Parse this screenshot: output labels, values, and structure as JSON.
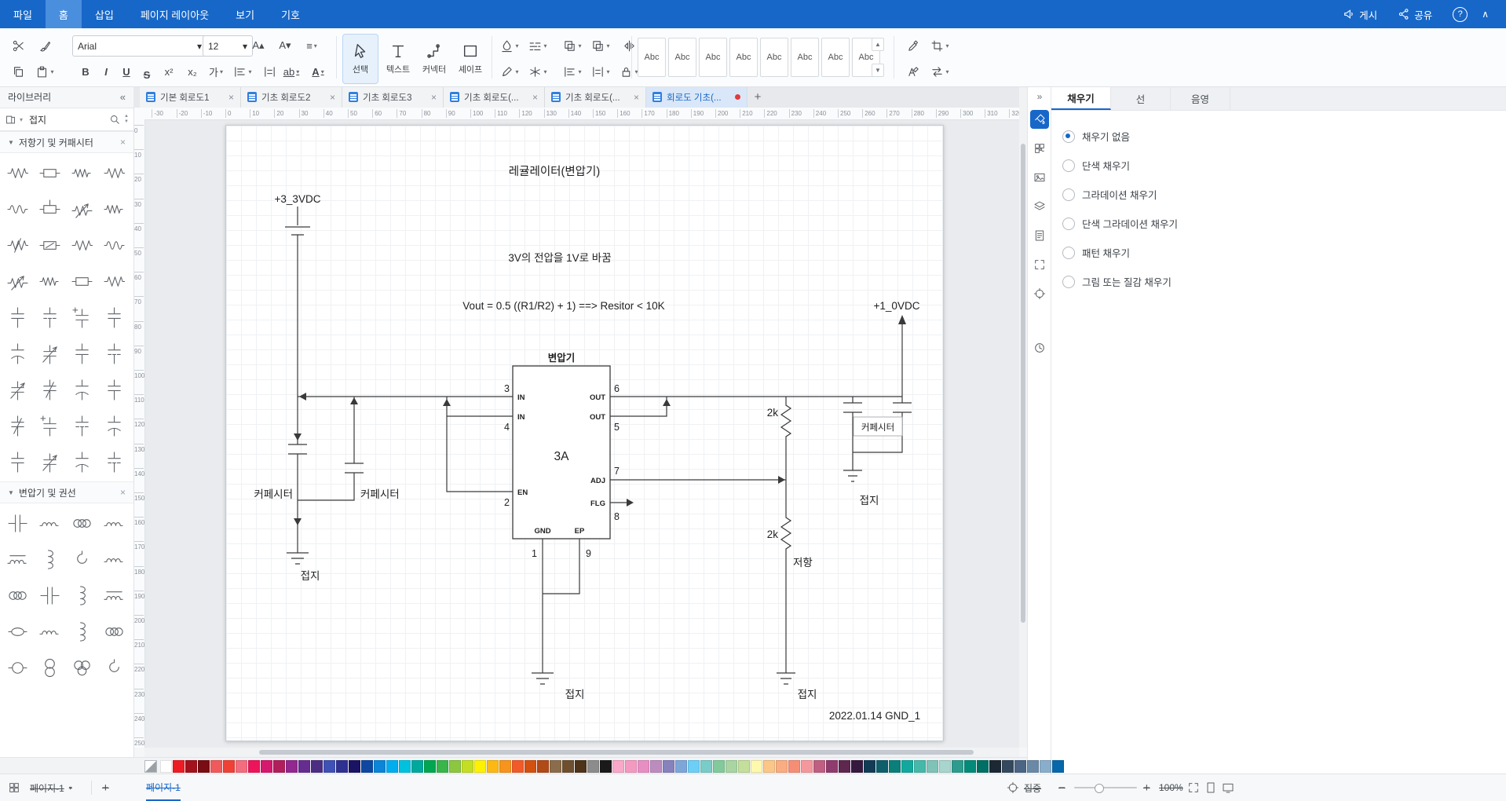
{
  "menubar": {
    "items": [
      {
        "id": "file",
        "label": "파일"
      },
      {
        "id": "home",
        "label": "홈",
        "active": true
      },
      {
        "id": "insert",
        "label": "삽입"
      },
      {
        "id": "page-layout",
        "label": "페이지 레이아웃"
      },
      {
        "id": "view",
        "label": "보기"
      },
      {
        "id": "symbols",
        "label": "기호"
      }
    ],
    "publish": "게시",
    "share": "공유"
  },
  "icons": {
    "dropdown": "▾",
    "spin_up": "▲",
    "spin_down": "▼",
    "tri_down": "▼",
    "collapse_left": "«",
    "expand_right": "»",
    "close": "×",
    "plus": "+",
    "minus": "−",
    "help": "?",
    "chevron_up": "∧",
    "bold": "B",
    "italic": "I",
    "underline": "U",
    "strike": "S",
    "superscript": "x²",
    "subscript": "x₂",
    "font_kr": "가",
    "highlight": "ab",
    "font_color": "A",
    "font_up": "A▴",
    "font_down": "A▾",
    "align": "≡"
  },
  "toolbar": {
    "font": "Arial",
    "font_size": "12",
    "select_label": "선택",
    "text_label": "텍스트",
    "connector_label": "커넥터",
    "shape_label": "셰이프",
    "style_sample": "Abc",
    "style_count": 8
  },
  "library": {
    "title": "라이브러리",
    "search_value": "접지",
    "sections": [
      {
        "title": "저항기 및 커패시터",
        "items": [
          "res-zz",
          "res-box",
          "res-zz-d",
          "res-zz",
          "res-wave",
          "res-tap",
          "res-arr",
          "res-zz-d",
          "res-slash",
          "res-box-s",
          "res-zz",
          "res-wave",
          "res-arr",
          "res-zz-d",
          "res-box",
          "res-zz",
          "cap-v",
          "cap-dash",
          "cap-plus",
          "cap-v",
          "cap-pol",
          "cap-arr",
          "cap-v",
          "cap-dash",
          "cap-arr",
          "cap-slash",
          "cap-pol",
          "cap-v",
          "cap-slash",
          "cap-plus",
          "cap-dash",
          "cap-pol",
          "cap-v",
          "cap-arr",
          "cap-pol",
          "cap-dash"
        ]
      },
      {
        "title": "변압기 및 권선",
        "items": [
          "pair-bars",
          "coil",
          "coil-loop",
          "coil",
          "coil-bar",
          "coil-v",
          "hook",
          "coil",
          "coil-loop",
          "pair-bars",
          "coil-v",
          "coil-bar",
          "bead",
          "coil",
          "coil-v",
          "coil-loop",
          "ring",
          "circ-v",
          "trans3",
          "hook"
        ]
      }
    ]
  },
  "tabs": {
    "items": [
      {
        "label": "기본 회로도1"
      },
      {
        "label": "기초 회로도2"
      },
      {
        "label": "기초 회로도3"
      },
      {
        "label": "기초 회로도(..."
      },
      {
        "label": "기초 회로도(..."
      },
      {
        "label": "회로도 기초(...",
        "active": true,
        "modified": true
      }
    ]
  },
  "ruler": {
    "h_start": -30,
    "h_end": 320,
    "v_start": 0,
    "v_end": 250,
    "step": 10
  },
  "circuit": {
    "title": "레귤레이터(변압기)",
    "vcc": "+3_3VDC",
    "vout": "+1_0VDC",
    "desc": "3V의 전압을 1V로 바꿈",
    "formula": "Vout = 0.5 ((R1/R2) + 1)  ==>  Resitor < 10K",
    "ic": {
      "name": "변압기",
      "part": "3A",
      "pins": {
        "in1": "IN",
        "in2": "IN",
        "en": "EN",
        "out1": "OUT",
        "out2": "OUT",
        "adj": "ADJ",
        "flg": "FLG",
        "gnd": "GND",
        "ep": "EP"
      },
      "nums": {
        "n3": "3",
        "n4": "4",
        "n2": "2",
        "n6": "6",
        "n5": "5",
        "n7": "7",
        "n8": "8",
        "n1": "1",
        "n9": "9"
      }
    },
    "cap1": "커페시터",
    "cap2": "커페시터",
    "cap3": "커페시터",
    "r1": "2k",
    "r2": "2k",
    "r2_name": "저항",
    "gnd1": "접지",
    "gnd2": "접지",
    "gnd3": "접지",
    "gnd4": "접지",
    "date": "2022.01.14 GND_1"
  },
  "right_panel": {
    "tabs": [
      {
        "label": "채우기",
        "active": true
      },
      {
        "label": "선"
      },
      {
        "label": "음영"
      }
    ],
    "options": [
      {
        "label": "채우기 없음",
        "selected": true
      },
      {
        "label": "단색 채우기"
      },
      {
        "label": "그라데이션 채우기"
      },
      {
        "label": "단색 그라데이션 채우기"
      },
      {
        "label": "패턴 채우기"
      },
      {
        "label": "그림 또는 질감 채우기"
      }
    ]
  },
  "palette": {
    "colors": [
      "#ffffff",
      "#ed1c24",
      "#a3111c",
      "#7a0c13",
      "#f05a5a",
      "#ef4136",
      "#f26d7d",
      "#ed145b",
      "#d6186e",
      "#b01e5c",
      "#92278f",
      "#662d91",
      "#4b2e83",
      "#3f51b5",
      "#2e3192",
      "#1b1464",
      "#0d47a1",
      "#0a85d8",
      "#00aeef",
      "#00c2de",
      "#00a99d",
      "#00a651",
      "#39b54a",
      "#8dc63f",
      "#c4df23",
      "#fff200",
      "#fdb913",
      "#f7941d",
      "#f15a29",
      "#d4500f",
      "#b04a17",
      "#8a6d4b",
      "#6e4f2e",
      "#4d3319",
      "#8c8c8c",
      "#1a1a1a",
      "#f9a8c9",
      "#f49ac1",
      "#e78fc3",
      "#bd8cbf",
      "#8781bd",
      "#7da7d9",
      "#6dcff6",
      "#7accc8",
      "#82ca9c",
      "#a8d5a2",
      "#c4df9b",
      "#fff9ae",
      "#fdc689",
      "#f9ad81",
      "#f68e76",
      "#f5989d",
      "#bf5f82",
      "#8f3b6e",
      "#5e2750",
      "#35193e",
      "#123c55",
      "#0f5e6b",
      "#0b7f7a",
      "#13a89e",
      "#46b8a9",
      "#7fc2b8",
      "#a8d5cd",
      "#2d9c8e",
      "#048a79",
      "#006f64",
      "#1c2833",
      "#34495e",
      "#4b6584",
      "#6a89a7",
      "#89aecb",
      "#0668ab"
    ]
  },
  "statusbar": {
    "page_selector": "페이지-1",
    "page_tab": "페이지-1",
    "focus": "집중",
    "zoom": "100%"
  }
}
